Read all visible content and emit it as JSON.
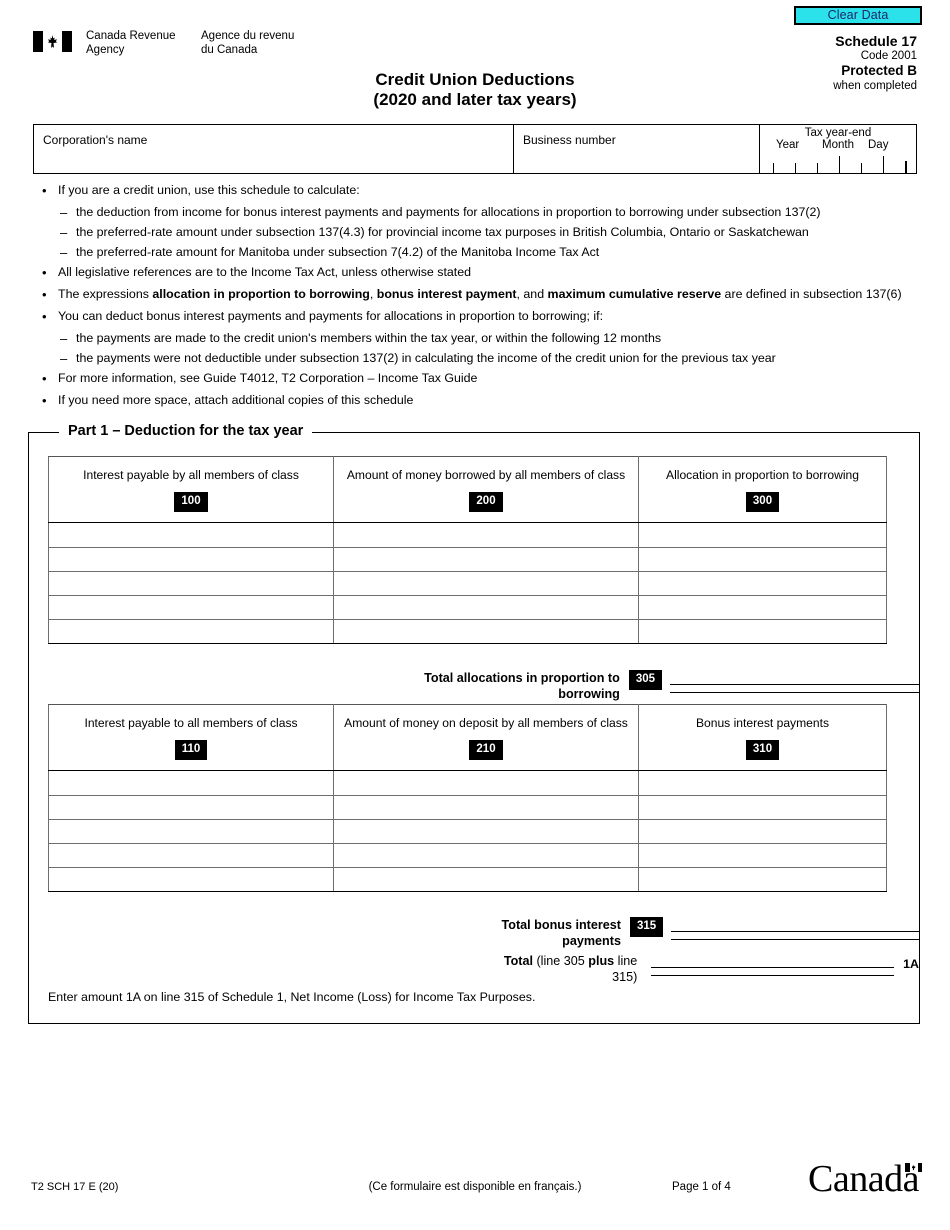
{
  "toolbar": {
    "clear_data_label": "Clear Data",
    "clear_data_bg": "#2ce2ea",
    "clear_data_text_color": "#1b2a6b"
  },
  "agency": {
    "name_en": "Canada Revenue\nAgency",
    "name_fr": "Agence du revenu\ndu Canada"
  },
  "header": {
    "schedule": "Schedule 17",
    "code": "Code 2001",
    "protected": "Protected B",
    "protected_note": "when completed",
    "title_line1": "Credit Union Deductions",
    "title_line2": "(2020 and later tax years)"
  },
  "identification": {
    "corporation_name_label": "Corporation's name",
    "corporation_name_value": "",
    "business_number_label": "Business number",
    "business_number_value": "",
    "tax_year_end_label": "Tax year-end",
    "year_label": "Year",
    "month_label": "Month",
    "day_label": "Day",
    "year_value": "",
    "month_value": "",
    "day_value": ""
  },
  "instructions": [
    {
      "type": "bullet",
      "text": "If you are a credit union, use this schedule to calculate:"
    },
    {
      "type": "dash",
      "text": "the deduction from income for bonus interest payments and payments for allocations in proportion to borrowing under subsection 137(2)"
    },
    {
      "type": "dash",
      "text": "the preferred-rate amount under subsection 137(4.3) for provincial income tax purposes in British Columbia, Ontario or Saskatchewan"
    },
    {
      "type": "dash",
      "text": "the preferred-rate amount for Manitoba under subsection 7(4.2) of the Manitoba Income Tax Act"
    },
    {
      "type": "bullet",
      "text": "All legislative references are to the Income Tax Act, unless otherwise stated"
    },
    {
      "type": "bullet",
      "html": true,
      "text": "The expressions <b>allocation in proportion to borrowing</b>, <b>bonus interest payment</b>, and <b>maximum cumulative reserve</b> are defined in subsection 137(6)"
    },
    {
      "type": "bullet",
      "text": "You can deduct bonus interest payments and payments for allocations in proportion to borrowing; if:"
    },
    {
      "type": "dash",
      "text": "the payments are made to the credit union's members within the tax year, or within the following 12 months"
    },
    {
      "type": "dash",
      "text": "the payments were not deductible under subsection 137(2) in calculating the income of the credit union for the previous tax year"
    },
    {
      "type": "bullet",
      "text": "For more information, see Guide T4012, T2 Corporation – Income Tax Guide"
    },
    {
      "type": "bullet",
      "text": "If you need more space, attach additional copies of this schedule"
    }
  ],
  "part1": {
    "legend": "Part 1 – Deduction for the tax year",
    "table1": {
      "columns": [
        {
          "label": "Interest payable by all members of class",
          "code": "100"
        },
        {
          "label": "Amount of money borrowed by all members of class",
          "code": "200"
        },
        {
          "label": "Allocation in proportion to borrowing",
          "code": "300"
        }
      ],
      "rows": [
        [
          "",
          "",
          ""
        ],
        [
          "",
          "",
          ""
        ],
        [
          "",
          "",
          ""
        ],
        [
          "",
          "",
          ""
        ],
        [
          "",
          "",
          ""
        ]
      ]
    },
    "total_allocations": {
      "label": "Total allocations in proportion to borrowing",
      "code": "305",
      "value": ""
    },
    "table2": {
      "columns": [
        {
          "label": "Interest payable to all members of class",
          "code": "110"
        },
        {
          "label": "Amount of money on deposit by all members of class",
          "code": "210"
        },
        {
          "label": "Bonus interest payments",
          "code": "310"
        }
      ],
      "rows": [
        [
          "",
          "",
          ""
        ],
        [
          "",
          "",
          ""
        ],
        [
          "",
          "",
          ""
        ],
        [
          "",
          "",
          ""
        ],
        [
          "",
          "",
          ""
        ]
      ]
    },
    "total_bonus": {
      "label": "Total bonus interest payments",
      "code": "315",
      "value": ""
    },
    "grand_total": {
      "label_bold": "Total",
      "label_rest": " (line 305 ",
      "label_bold2": "plus",
      "label_rest2": " line 315)",
      "value": "",
      "tag": "1A"
    },
    "enter_note": "Enter amount 1A on line 315 of Schedule 1, Net Income (Loss) for Income Tax Purposes."
  },
  "footer": {
    "form_code": "T2 SCH 17 E (20)",
    "french_note": "(Ce formulaire est disponible en français.)",
    "page": "Page 1 of 4",
    "wordmark": "Canad"
  }
}
